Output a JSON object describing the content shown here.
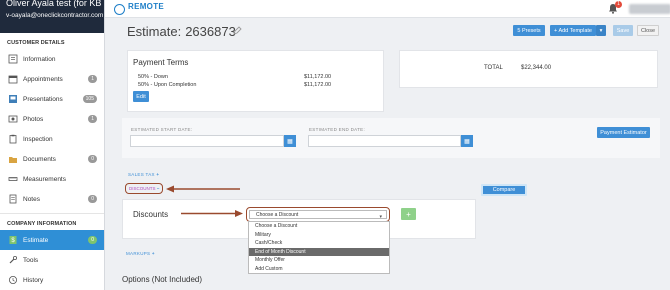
{
  "sidebar": {
    "user_name": "Oliver Ayala test (for KB purposes)",
    "user_email": "v-oayala@oneclickcontractor.com",
    "customer_section": "CUSTOMER DETAILS",
    "items": [
      {
        "label": "Information",
        "badge": ""
      },
      {
        "label": "Appointments",
        "badge": "1"
      },
      {
        "label": "Presentations",
        "badge": "105"
      },
      {
        "label": "Photos",
        "badge": "1"
      },
      {
        "label": "Inspection",
        "badge": ""
      },
      {
        "label": "Documents",
        "badge": "0"
      },
      {
        "label": "Measurements",
        "badge": ""
      },
      {
        "label": "Notes",
        "badge": "0"
      }
    ],
    "company_section": "COMPANY INFORMATION",
    "company_items": [
      {
        "label": "Estimate",
        "badge": "0"
      },
      {
        "label": "Tools",
        "badge": ""
      },
      {
        "label": "History",
        "badge": ""
      }
    ]
  },
  "topbar": {
    "logo_text": "REMOTE",
    "notification_count": "1"
  },
  "header": {
    "title": "Estimate:",
    "estimate_number": "2636873",
    "presets_label": "5 Presets",
    "add_template_label": "+ Add Template",
    "save_label": "Save",
    "close_label": "Close"
  },
  "payment_terms": {
    "title": "Payment Terms",
    "rows": [
      {
        "label": "50% - Down",
        "amount": "$11,172.00"
      },
      {
        "label": "50% - Upon Completion",
        "amount": "$11,172.00"
      }
    ],
    "edit_label": "Edit"
  },
  "totals": {
    "label": "TOTAL",
    "value": "$22,344.00"
  },
  "dates": {
    "start_label": "ESTIMATED START DATE:",
    "end_label": "ESTIMATED END DATE:",
    "payment_estimator_label": "Payment Estimator"
  },
  "links": {
    "sales_tax": "SALES TAX",
    "discounts": "DISCOUNTS",
    "markups": "MARKUPS",
    "compare": "Compare"
  },
  "discounts": {
    "title": "Discounts",
    "selected": "Choose a Discount",
    "options": [
      "Choose a Discount",
      "Military",
      "Cash/Check",
      "End of Month Discount",
      "Monthly Offer",
      "Add Custom"
    ],
    "highlighted_index": 3,
    "add_label": "+"
  },
  "options_section": {
    "title": "Options  (Not Included)"
  },
  "colors": {
    "accent": "#3f8fd6",
    "annotation": "#9a4a2e",
    "sidebar_header": "#1f2a3c",
    "active_item": "#2f8fd6"
  }
}
